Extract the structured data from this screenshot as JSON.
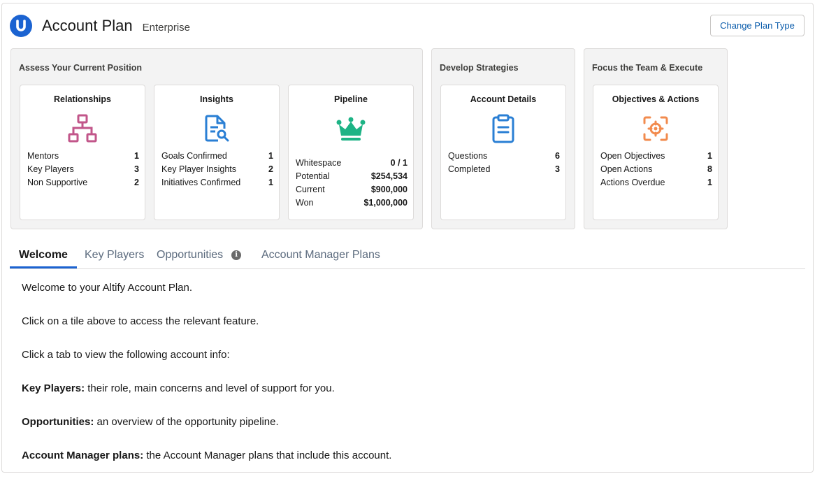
{
  "header": {
    "logo_letter": "U",
    "title": "Account Plan",
    "subtitle": "Enterprise",
    "change_plan_label": "Change Plan Type"
  },
  "groups": {
    "assess": {
      "title": "Assess Your Current Position",
      "relationships": {
        "title": "Relationships",
        "icon": "org-chart-icon",
        "stats": [
          {
            "label": "Mentors",
            "value": "1"
          },
          {
            "label": "Key Players",
            "value": "3"
          },
          {
            "label": "Non Supportive",
            "value": "2"
          }
        ]
      },
      "insights": {
        "title": "Insights",
        "icon": "document-search-icon",
        "stats": [
          {
            "label": "Goals Confirmed",
            "value": "1"
          },
          {
            "label": "Key Player Insights",
            "value": "2"
          },
          {
            "label": "Initiatives Confirmed",
            "value": "1"
          }
        ]
      },
      "pipeline": {
        "title": "Pipeline",
        "icon": "crown-icon",
        "stats": [
          {
            "label": "Whitespace",
            "value": "0 / 1"
          },
          {
            "label": "Potential",
            "value": "$254,534"
          },
          {
            "label": "Current",
            "value": "$900,000"
          },
          {
            "label": "Won",
            "value": "$1,000,000"
          }
        ]
      }
    },
    "develop": {
      "title": "Develop Strategies",
      "account_details": {
        "title": "Account Details",
        "icon": "clipboard-icon",
        "stats": [
          {
            "label": "Questions",
            "value": "6"
          },
          {
            "label": "Completed",
            "value": "3"
          }
        ]
      }
    },
    "focus": {
      "title": "Focus the Team & Execute",
      "objectives": {
        "title": "Objectives & Actions",
        "icon": "target-icon",
        "stats": [
          {
            "label": "Open Objectives",
            "value": "1"
          },
          {
            "label": "Open Actions",
            "value": "8"
          },
          {
            "label": "Actions Overdue",
            "value": "1"
          }
        ]
      }
    }
  },
  "tabs": [
    {
      "label": "Welcome",
      "active": true
    },
    {
      "label": "Key Players",
      "active": false
    },
    {
      "label": "Opportunities",
      "active": false
    },
    {
      "label": "Account Manager Plans",
      "active": false
    }
  ],
  "info_icon_glyph": "i",
  "welcome": {
    "intro": "Welcome to your Altify Account Plan.",
    "tile_hint": "Click on a tile above to access the relevant feature.",
    "tab_hint": "Click a tab to view the following account info:",
    "key_players_label": "Key Players:",
    "key_players_text": " their role, main concerns and level of support for you.",
    "opportunities_label": "Opportunities:",
    "opportunities_text": " an overview of the opportunity pipeline.",
    "amp_label": "Account Manager plans:",
    "amp_text": " the Account Manager plans that include this account."
  },
  "colors": {
    "brand": "#1b63d1",
    "relationships": "#c2568a",
    "insights": "#2a7fd4",
    "pipeline": "#1db385",
    "account_details": "#2a7fd4",
    "objectives": "#f28b4e"
  }
}
